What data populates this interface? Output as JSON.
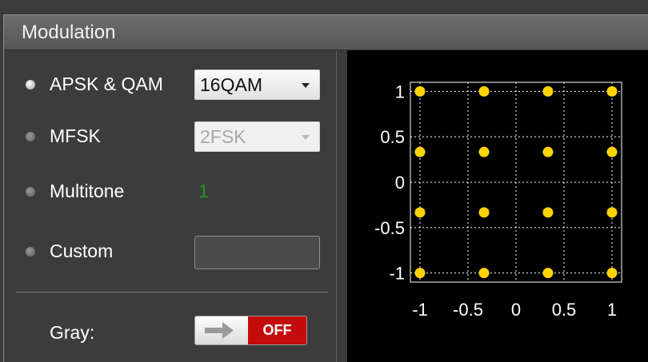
{
  "panel": {
    "title": "Modulation"
  },
  "modulation_options": [
    {
      "label": "APSK & QAM",
      "selected": true,
      "control": "combo",
      "value": "16QAM",
      "enabled": true
    },
    {
      "label": "MFSK",
      "selected": false,
      "control": "combo",
      "value": "2FSK",
      "enabled": false
    },
    {
      "label": "Multitone",
      "selected": false,
      "control": "value",
      "value": "1"
    },
    {
      "label": "Custom",
      "selected": false,
      "control": "textbox",
      "value": ""
    }
  ],
  "gray": {
    "label": "Gray:",
    "toggle_state": "OFF",
    "toggle_on": false,
    "off_color": "#c40c0c"
  },
  "colors": {
    "point": "#ffd400",
    "multitone_value": "#1f9a24",
    "plot_background": "#000000"
  },
  "chart_data": {
    "type": "scatter",
    "title": "",
    "xlabel": "",
    "ylabel": "",
    "xlim": [
      -1.1,
      1.1
    ],
    "ylim": [
      -1.1,
      1.1
    ],
    "x_ticks": [
      -1,
      -0.5,
      0,
      0.5,
      1
    ],
    "y_ticks": [
      1,
      0.5,
      0,
      -0.5,
      -1
    ],
    "x_tick_labels": [
      "-1",
      "-0.5",
      "0",
      "0.5",
      "1"
    ],
    "y_tick_labels": [
      "1",
      "0.5",
      "0",
      "-0.5",
      "-1"
    ],
    "grid": true,
    "points": [
      {
        "x": -1,
        "y": 1
      },
      {
        "x": -0.333,
        "y": 1
      },
      {
        "x": 0.333,
        "y": 1
      },
      {
        "x": 1,
        "y": 1
      },
      {
        "x": -1,
        "y": 0.333
      },
      {
        "x": -0.333,
        "y": 0.333
      },
      {
        "x": 0.333,
        "y": 0.333
      },
      {
        "x": 1,
        "y": 0.333
      },
      {
        "x": -1,
        "y": -0.333
      },
      {
        "x": -0.333,
        "y": -0.333
      },
      {
        "x": 0.333,
        "y": -0.333
      },
      {
        "x": 1,
        "y": -0.333
      },
      {
        "x": -1,
        "y": -1
      },
      {
        "x": -0.333,
        "y": -1
      },
      {
        "x": 0.333,
        "y": -1
      },
      {
        "x": 1,
        "y": -1
      }
    ]
  }
}
